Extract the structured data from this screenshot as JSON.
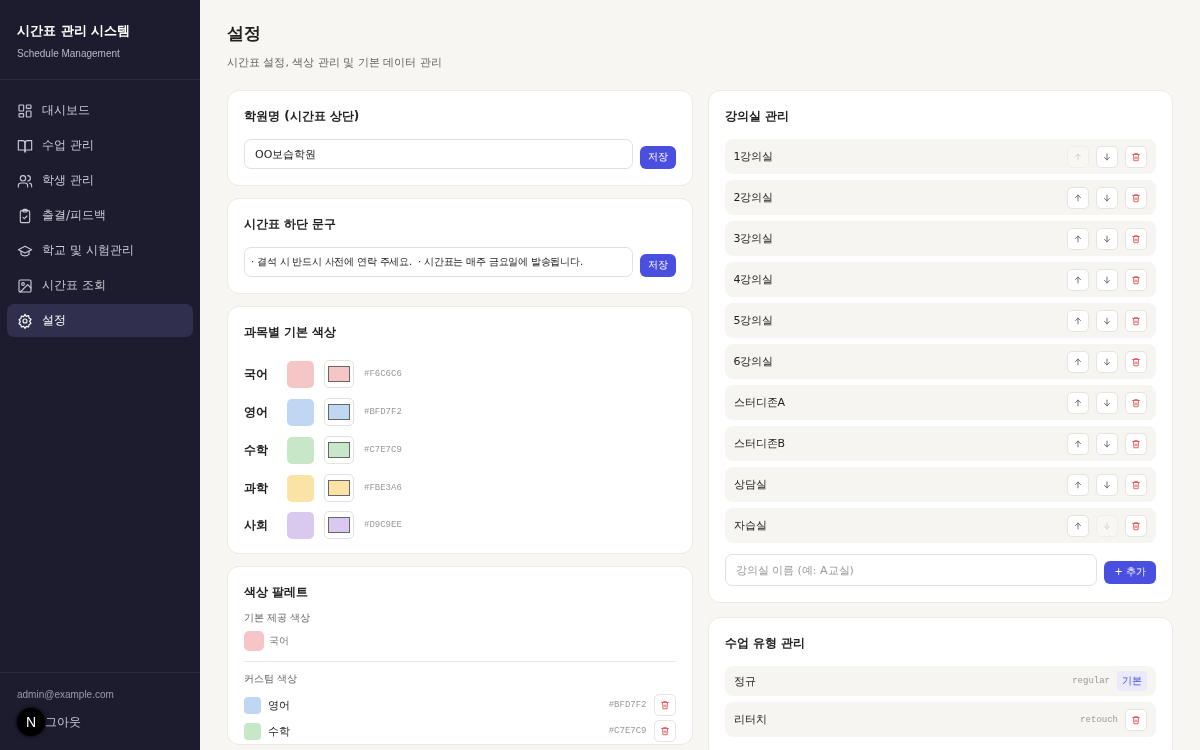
{
  "sidebar": {
    "title": "시간표 관리 시스템",
    "subtitle": "Schedule Management",
    "items": [
      {
        "label": "대시보드",
        "selected": false
      },
      {
        "label": "수업 관리",
        "selected": false
      },
      {
        "label": "학생 관리",
        "selected": false
      },
      {
        "label": "출결/피드백",
        "selected": false
      },
      {
        "label": "학교 및 시험관리",
        "selected": false
      },
      {
        "label": "시간표 조회",
        "selected": false
      },
      {
        "label": "설정",
        "selected": true
      }
    ],
    "user_email": "admin@example.com",
    "badge": "N",
    "logout": "그아웃"
  },
  "page": {
    "title": "설정",
    "subtitle": "시간표 설정, 색상 관리 및 기본 데이터 관리"
  },
  "academy_name": {
    "title": "학원명 (시간표 상단)",
    "value": "OO보습학원",
    "button": "저장"
  },
  "footer_text": {
    "title": "시간표 하단 문구",
    "value": "· 결석 시 반드시 사전에 연락 주세요.  · 시간표는 매주 금요일에 발송됩니다.",
    "button": "저장"
  },
  "subject_colors": {
    "title": "과목별 기본 색상",
    "items": [
      {
        "name": "국어",
        "color": "#f6c6c6",
        "hex": "#F6C6C6"
      },
      {
        "name": "영어",
        "color": "#bfd7f2",
        "hex": "#BFD7F2"
      },
      {
        "name": "수학",
        "color": "#c7e7c9",
        "hex": "#C7E7C9"
      },
      {
        "name": "과학",
        "color": "#fbe3a6",
        "hex": "#FBE3A6"
      },
      {
        "name": "사회",
        "color": "#d9c9ee",
        "hex": "#D9C9EE"
      }
    ]
  },
  "palette": {
    "title": "색상 팔레트",
    "default_label": "기본 제공 색상",
    "defaults": [
      {
        "name": "국어",
        "color": "#f6c6c6"
      }
    ],
    "custom_label": "커스텀 색상",
    "custom": [
      {
        "name": "영어",
        "color": "#bfd7f2",
        "hex": "#BFD7F2"
      },
      {
        "name": "수학",
        "color": "#c7e7c9",
        "hex": "#C7E7C9"
      }
    ]
  },
  "rooms": {
    "title": "강의실 관리",
    "items": [
      {
        "name": "1강의실",
        "up_disabled": true,
        "down_disabled": false
      },
      {
        "name": "2강의실",
        "up_disabled": false,
        "down_disabled": false
      },
      {
        "name": "3강의실",
        "up_disabled": false,
        "down_disabled": false
      },
      {
        "name": "4강의실",
        "up_disabled": false,
        "down_disabled": false
      },
      {
        "name": "5강의실",
        "up_disabled": false,
        "down_disabled": false
      },
      {
        "name": "6강의실",
        "up_disabled": false,
        "down_disabled": false
      },
      {
        "name": "스터디존A",
        "up_disabled": false,
        "down_disabled": false
      },
      {
        "name": "스터디존B",
        "up_disabled": false,
        "down_disabled": false
      },
      {
        "name": "상담실",
        "up_disabled": false,
        "down_disabled": false
      },
      {
        "name": "자습실",
        "up_disabled": false,
        "down_disabled": true
      }
    ],
    "placeholder": "강의실 이름 (예: A교실)",
    "add_button": "+ 추가"
  },
  "class_types": {
    "title": "수업 유형 관리",
    "items": [
      {
        "name": "정규",
        "code": "regular",
        "kind": "default",
        "badge": "기본"
      },
      {
        "name": "리터치",
        "code": "retouch",
        "kind": "custom"
      }
    ]
  }
}
